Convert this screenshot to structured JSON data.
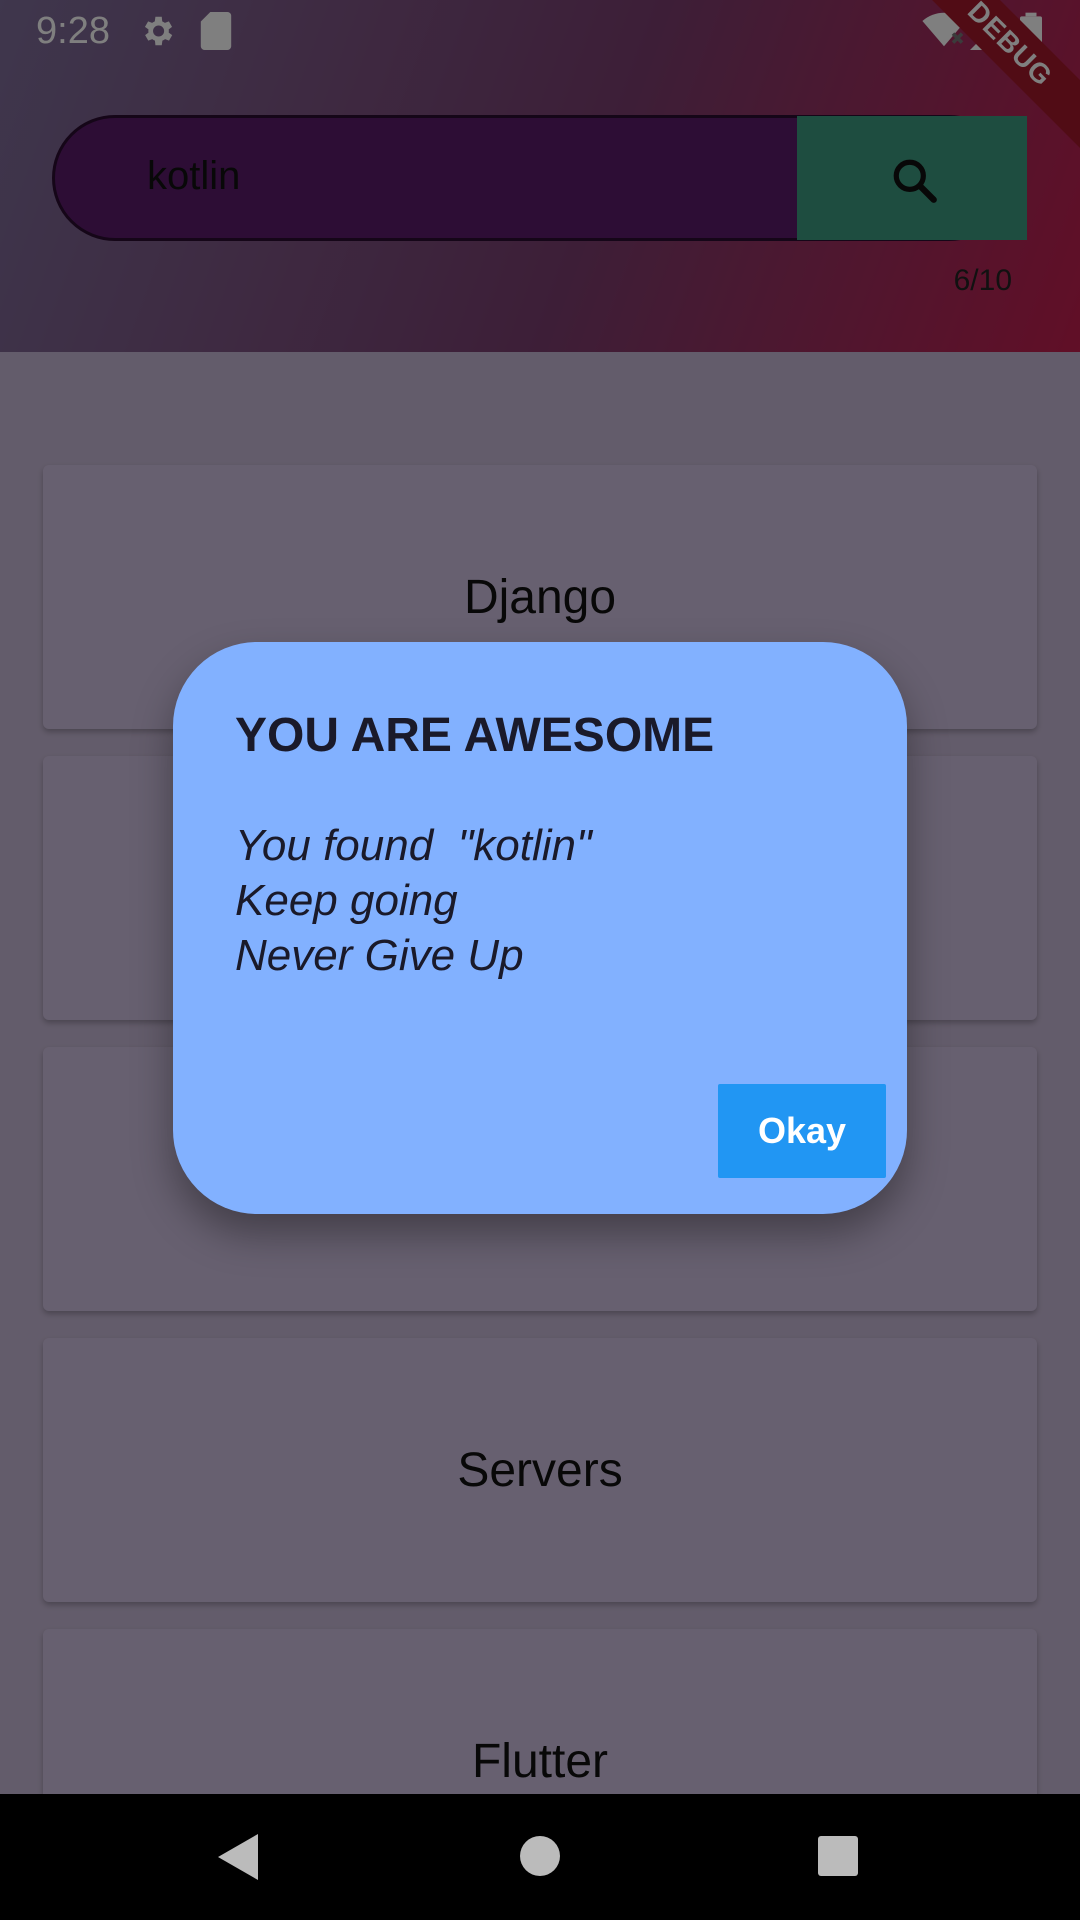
{
  "status_bar": {
    "time": "9:28",
    "icons": [
      "gear-icon",
      "sd-card-icon",
      "wifi-icon",
      "signal-icon",
      "battery-icon"
    ]
  },
  "debug_banner": "DEBUG",
  "search": {
    "value": "kotlin",
    "button_icon": "search-icon",
    "counter": "6/10"
  },
  "list": {
    "items": [
      "Django",
      "",
      "",
      "Servers",
      "Flutter"
    ]
  },
  "dialog": {
    "title": "YOU ARE AWESOME",
    "lines": [
      "You found  \"kotlin\"",
      "Keep going",
      "Never Give Up"
    ],
    "okay_label": "Okay"
  },
  "nav": {
    "icons": [
      "back-icon",
      "home-icon",
      "recents-icon"
    ]
  },
  "colors": {
    "search_field": "#5a1b6b",
    "search_button": "#3c9a80",
    "dialog_bg": "#82b1ff",
    "okay_button": "#2196f3"
  }
}
